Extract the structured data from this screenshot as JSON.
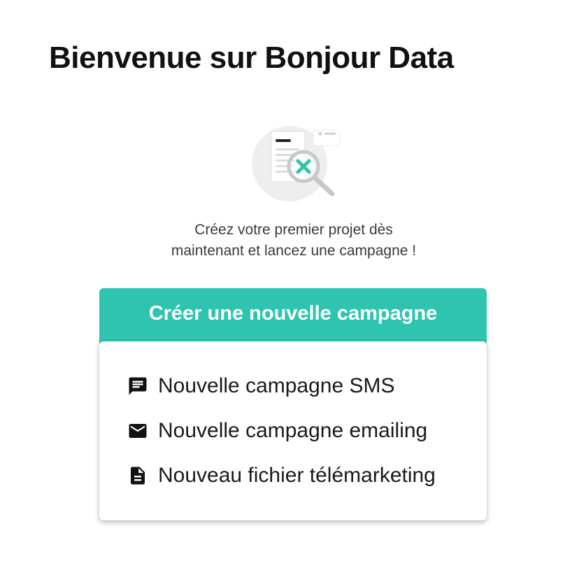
{
  "page": {
    "title": "Bienvenue sur Bonjour Data",
    "illustration_icon": "empty-search-icon",
    "subtitle_line1": "Créez votre premier projet dès",
    "subtitle_line2": "maintenant et lancez une campagne !"
  },
  "cta": {
    "label": "Créer une nouvelle campagne",
    "color": "#2ec4b0"
  },
  "menu": {
    "items": [
      {
        "label": "Nouvelle campagne SMS",
        "icon": "sms-icon"
      },
      {
        "label": "Nouvelle campagne emailing",
        "icon": "email-icon"
      },
      {
        "label": "Nouveau fichier télémarketing",
        "icon": "document-icon"
      }
    ]
  }
}
